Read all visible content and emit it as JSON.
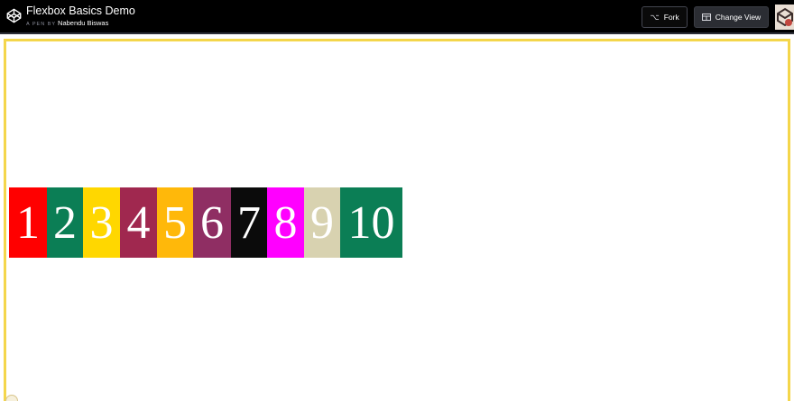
{
  "header": {
    "pen_title": "Flexbox Basics Demo",
    "pen_by": "A PEN BY",
    "author": "Nabendu Biswas",
    "fork_label": "Fork",
    "change_view_label": "Change View"
  },
  "icons": {
    "logo": "codepen-logo-icon",
    "fork": "fork-icon",
    "change_view": "layout-grid-icon",
    "avatar": "user-avatar"
  },
  "result": {
    "border_color": "#f4d64b",
    "items": [
      {
        "label": "1",
        "color": "#ff0000"
      },
      {
        "label": "2",
        "color": "#0b7e55"
      },
      {
        "label": "3",
        "color": "#ffd700"
      },
      {
        "label": "4",
        "color": "#a0284f"
      },
      {
        "label": "5",
        "color": "#ffb80a"
      },
      {
        "label": "6",
        "color": "#8f2e63"
      },
      {
        "label": "7",
        "color": "#0b0b0b"
      },
      {
        "label": "8",
        "color": "#ff00ff"
      },
      {
        "label": "9",
        "color": "#d8d2b0"
      },
      {
        "label": "10",
        "color": "#0b7e55"
      }
    ]
  }
}
